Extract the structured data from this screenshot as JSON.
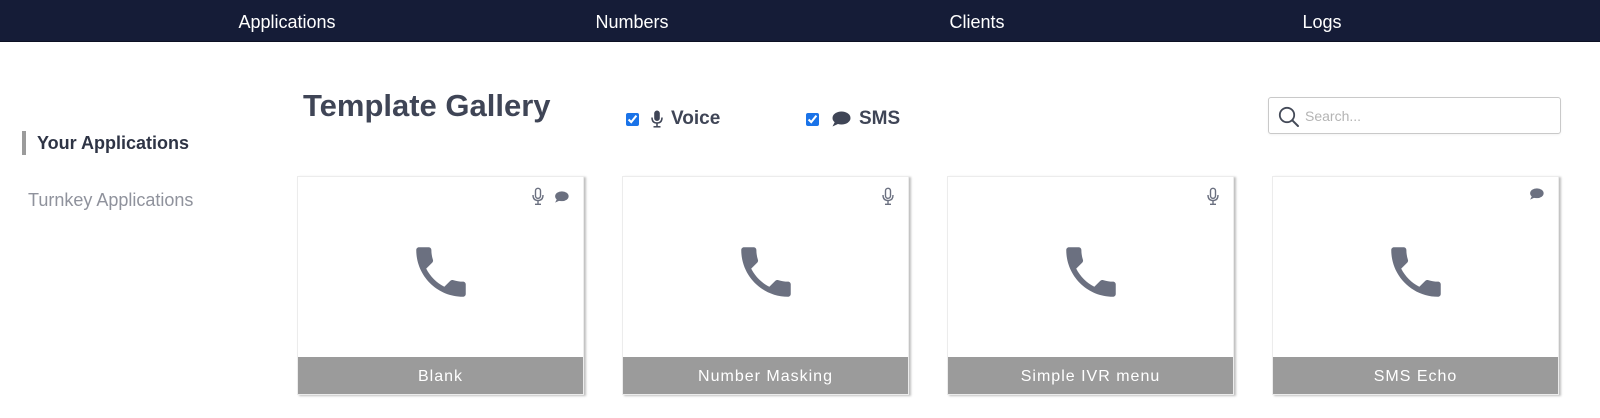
{
  "nav": {
    "items": [
      "Applications",
      "Numbers",
      "Clients",
      "Logs"
    ]
  },
  "sidebar": {
    "active": "Your Applications",
    "other": "Turnkey Applications"
  },
  "gallery": {
    "title": "Template Gallery",
    "filters": {
      "voice": {
        "label": "Voice",
        "checked": true,
        "icon": "microphone-icon"
      },
      "sms": {
        "label": "SMS",
        "checked": true,
        "icon": "speech-bubble-icon"
      }
    },
    "search": {
      "placeholder": "Search...",
      "value": ""
    },
    "cards": [
      {
        "label": "Blank",
        "voice": true,
        "sms": true,
        "icon": "phone-icon"
      },
      {
        "label": "Number Masking",
        "voice": true,
        "sms": false,
        "icon": "phone-icon"
      },
      {
        "label": "Simple IVR menu",
        "voice": true,
        "sms": false,
        "icon": "phone-icon"
      },
      {
        "label": "SMS Echo",
        "voice": false,
        "sms": true,
        "icon": "phone-icon"
      }
    ]
  },
  "colors": {
    "nav_bg": "#151c37",
    "card_label_bg": "#9b9b9b",
    "icon_gray": "#6b7080",
    "checkbox_blue": "#1a73e8"
  }
}
